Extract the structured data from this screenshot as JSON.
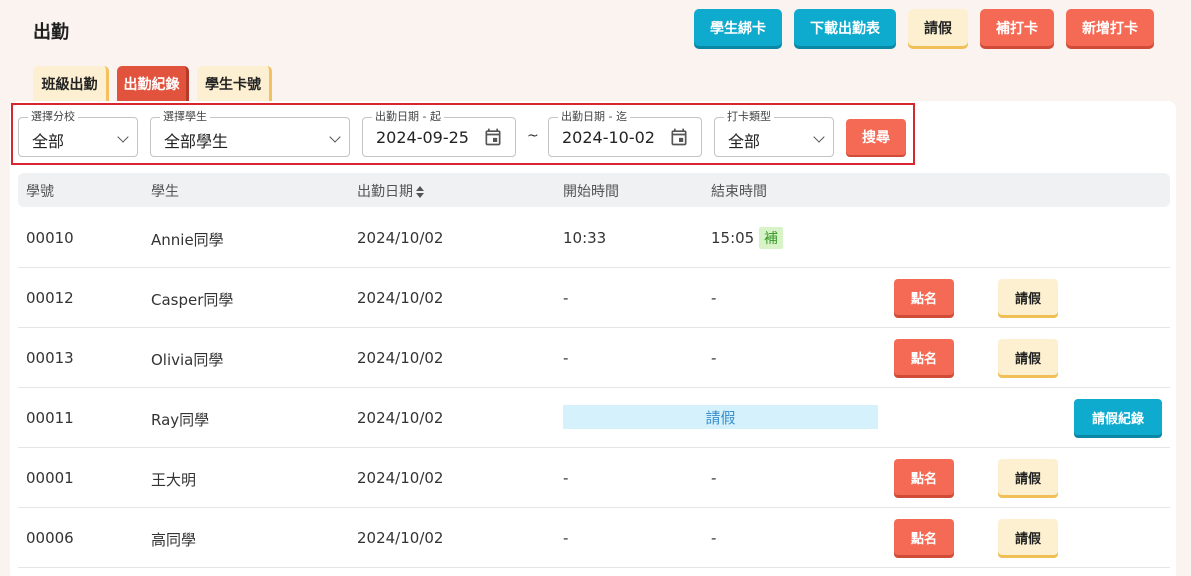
{
  "page": {
    "title": "出勤"
  },
  "top_actions": {
    "bind_card": "學生綁卡",
    "download": "下載出勤表",
    "leave": "請假",
    "makeup_punch": "補打卡",
    "add_punch": "新增打卡"
  },
  "tabs": [
    {
      "label": "班級出勤",
      "active": false
    },
    {
      "label": "出勤紀錄",
      "active": true
    },
    {
      "label": "學生卡號",
      "active": false
    }
  ],
  "filters": {
    "branch": {
      "label": "選擇分校",
      "value": "全部"
    },
    "student": {
      "label": "選擇學生",
      "value": "全部學生"
    },
    "date_from": {
      "label": "出勤日期 - 起",
      "value": "2024-09-25"
    },
    "separator": "~",
    "date_to": {
      "label": "出勤日期 - 迄",
      "value": "2024-10-02"
    },
    "punch_type": {
      "label": "打卡類型",
      "value": "全部"
    },
    "search_label": "搜尋"
  },
  "table": {
    "columns": {
      "id": "學號",
      "student": "學生",
      "date": "出勤日期",
      "start": "開始時間",
      "end": "結束時間"
    },
    "action_labels": {
      "rollcall": "點名",
      "leave": "請假",
      "leave_record": "請假紀錄"
    },
    "rows": [
      {
        "id": "00010",
        "name": "Annie同學",
        "date": "2024/10/02",
        "start": "10:33",
        "end": "15:05",
        "badge": "補"
      },
      {
        "id": "00012",
        "name": "Casper同學",
        "date": "2024/10/02",
        "start": "-",
        "end": "-"
      },
      {
        "id": "00013",
        "name": "Olivia同學",
        "date": "2024/10/02",
        "start": "-",
        "end": "-"
      },
      {
        "id": "00011",
        "name": "Ray同學",
        "date": "2024/10/02",
        "status": "請假"
      },
      {
        "id": "00001",
        "name": "王大明",
        "date": "2024/10/02",
        "start": "-",
        "end": "-"
      },
      {
        "id": "00006",
        "name": "高同學",
        "date": "2024/10/02",
        "start": "-",
        "end": "-"
      }
    ]
  },
  "colors": {
    "accent_red": "#f46a54",
    "accent_teal": "#0fabcf",
    "cream": "#fcf0d0",
    "highlight_border": "#d8252f"
  }
}
